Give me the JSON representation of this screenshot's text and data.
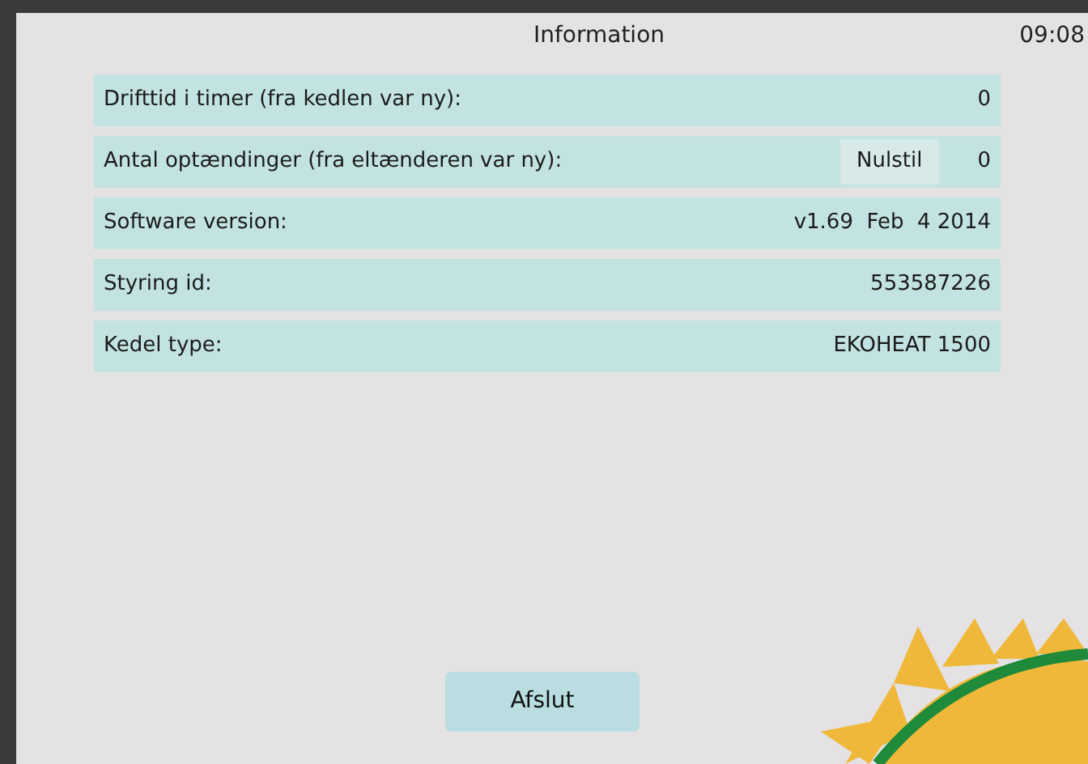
{
  "header": {
    "title": "Information",
    "time": "09:08"
  },
  "rows": [
    {
      "kind": "plain",
      "label": "Drifttid i timer (fra kedlen var ny):",
      "value": "0"
    },
    {
      "kind": "with-button",
      "label": "Antal optændinger (fra eltænderen var ny):",
      "button": "Nulstil",
      "value": "0"
    },
    {
      "kind": "plain",
      "label": "Software version:",
      "value": "v1.69  Feb  4 2014"
    },
    {
      "kind": "plain",
      "label": "Styring id:",
      "value": "553587226"
    },
    {
      "kind": "plain",
      "label": "Kedel type:",
      "value": "EKOHEAT 1500"
    }
  ],
  "footer": {
    "button": "Afslut"
  }
}
